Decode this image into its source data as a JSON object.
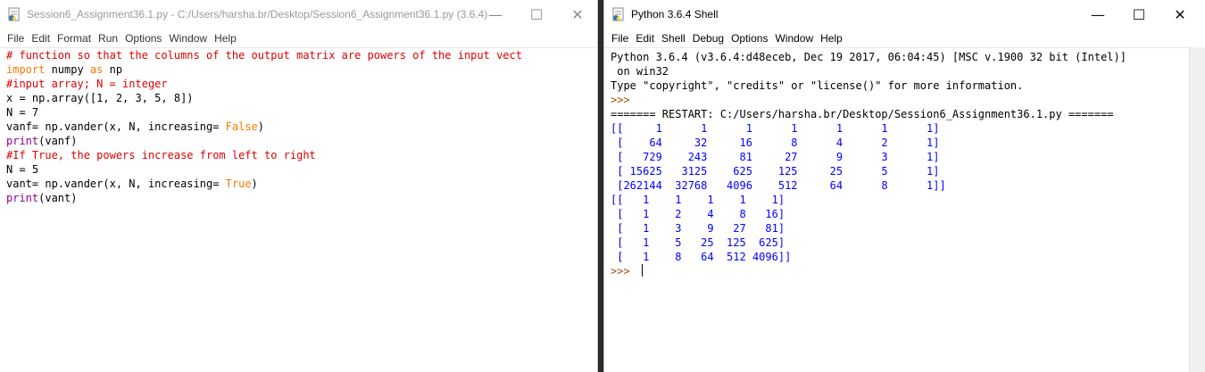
{
  "editor": {
    "title": "Session6_Assignment36.1.py - C:/Users/harsha.br/Desktop/Session6_Assignment36.1.py (3.6.4)",
    "menu": [
      "File",
      "Edit",
      "Format",
      "Run",
      "Options",
      "Window",
      "Help"
    ],
    "lines": [
      [
        {
          "t": "# function so that the columns of the output matrix are powers of the input vect",
          "c": "cm"
        }
      ],
      [
        {
          "t": "import",
          "c": "kw"
        },
        {
          "t": " numpy ",
          "c": ""
        },
        {
          "t": "as",
          "c": "kw"
        },
        {
          "t": " np",
          "c": ""
        }
      ],
      [
        {
          "t": "#input array; N = integer",
          "c": "cm"
        }
      ],
      [
        {
          "t": "x = np.array([1, 2, 3, 5, 8])",
          "c": ""
        }
      ],
      [
        {
          "t": "N = 7",
          "c": ""
        }
      ],
      [
        {
          "t": "vanf= np.vander(x, N, increasing= ",
          "c": ""
        },
        {
          "t": "False",
          "c": "kw"
        },
        {
          "t": ")",
          "c": ""
        }
      ],
      [
        {
          "t": "print",
          "c": "prn"
        },
        {
          "t": "(vanf)",
          "c": ""
        }
      ],
      [
        {
          "t": "#If True, the powers increase from left to right",
          "c": "cm"
        }
      ],
      [
        {
          "t": "N = 5",
          "c": ""
        }
      ],
      [
        {
          "t": "vant= np.vander(x, N, increasing= ",
          "c": ""
        },
        {
          "t": "True",
          "c": "kw"
        },
        {
          "t": ")",
          "c": ""
        }
      ],
      [
        {
          "t": "print",
          "c": "prn"
        },
        {
          "t": "(vant)",
          "c": ""
        }
      ]
    ]
  },
  "shell": {
    "title": "Python 3.6.4 Shell",
    "menu": [
      "File",
      "Edit",
      "Shell",
      "Debug",
      "Options",
      "Window",
      "Help"
    ],
    "lines": [
      [
        {
          "t": "Python 3.6.4 (v3.6.4:d48eceb, Dec 19 2017, 06:04:45) [MSC v.1900 32 bit (Intel)]",
          "c": ""
        }
      ],
      [
        {
          "t": " on win32",
          "c": ""
        }
      ],
      [
        {
          "t": "Type \"copyright\", \"credits\" or \"license()\" for more information.",
          "c": ""
        }
      ],
      [
        {
          "t": ">>> ",
          "c": "prompt"
        }
      ],
      [
        {
          "t": "======= RESTART: C:/Users/harsha.br/Desktop/Session6_Assignment36.1.py =======",
          "c": ""
        }
      ],
      [
        {
          "t": "[[     1      1      1      1      1      1      1]",
          "c": "out"
        }
      ],
      [
        {
          "t": " [    64     32     16      8      4      2      1]",
          "c": "out"
        }
      ],
      [
        {
          "t": " [   729    243     81     27      9      3      1]",
          "c": "out"
        }
      ],
      [
        {
          "t": " [ 15625   3125    625    125     25      5      1]",
          "c": "out"
        }
      ],
      [
        {
          "t": " [262144  32768   4096    512     64      8      1]]",
          "c": "out"
        }
      ],
      [
        {
          "t": "[[   1    1    1    1    1]",
          "c": "out"
        }
      ],
      [
        {
          "t": " [   1    2    4    8   16]",
          "c": "out"
        }
      ],
      [
        {
          "t": " [   1    3    9   27   81]",
          "c": "out"
        }
      ],
      [
        {
          "t": " [   1    5   25  125  625]",
          "c": "out"
        }
      ],
      [
        {
          "t": " [   1    8   64  512 4096]]",
          "c": "out"
        }
      ],
      [
        {
          "t": ">>> ",
          "c": "prompt"
        }
      ]
    ]
  },
  "window_controls": {
    "minimize": "—",
    "maximize": "☐",
    "close": "✕"
  },
  "colors": {
    "keyword": "#ff7700",
    "comment": "#dd0000",
    "output": "#0000ff",
    "prompt": "#a05000",
    "builtin": "#900090"
  }
}
